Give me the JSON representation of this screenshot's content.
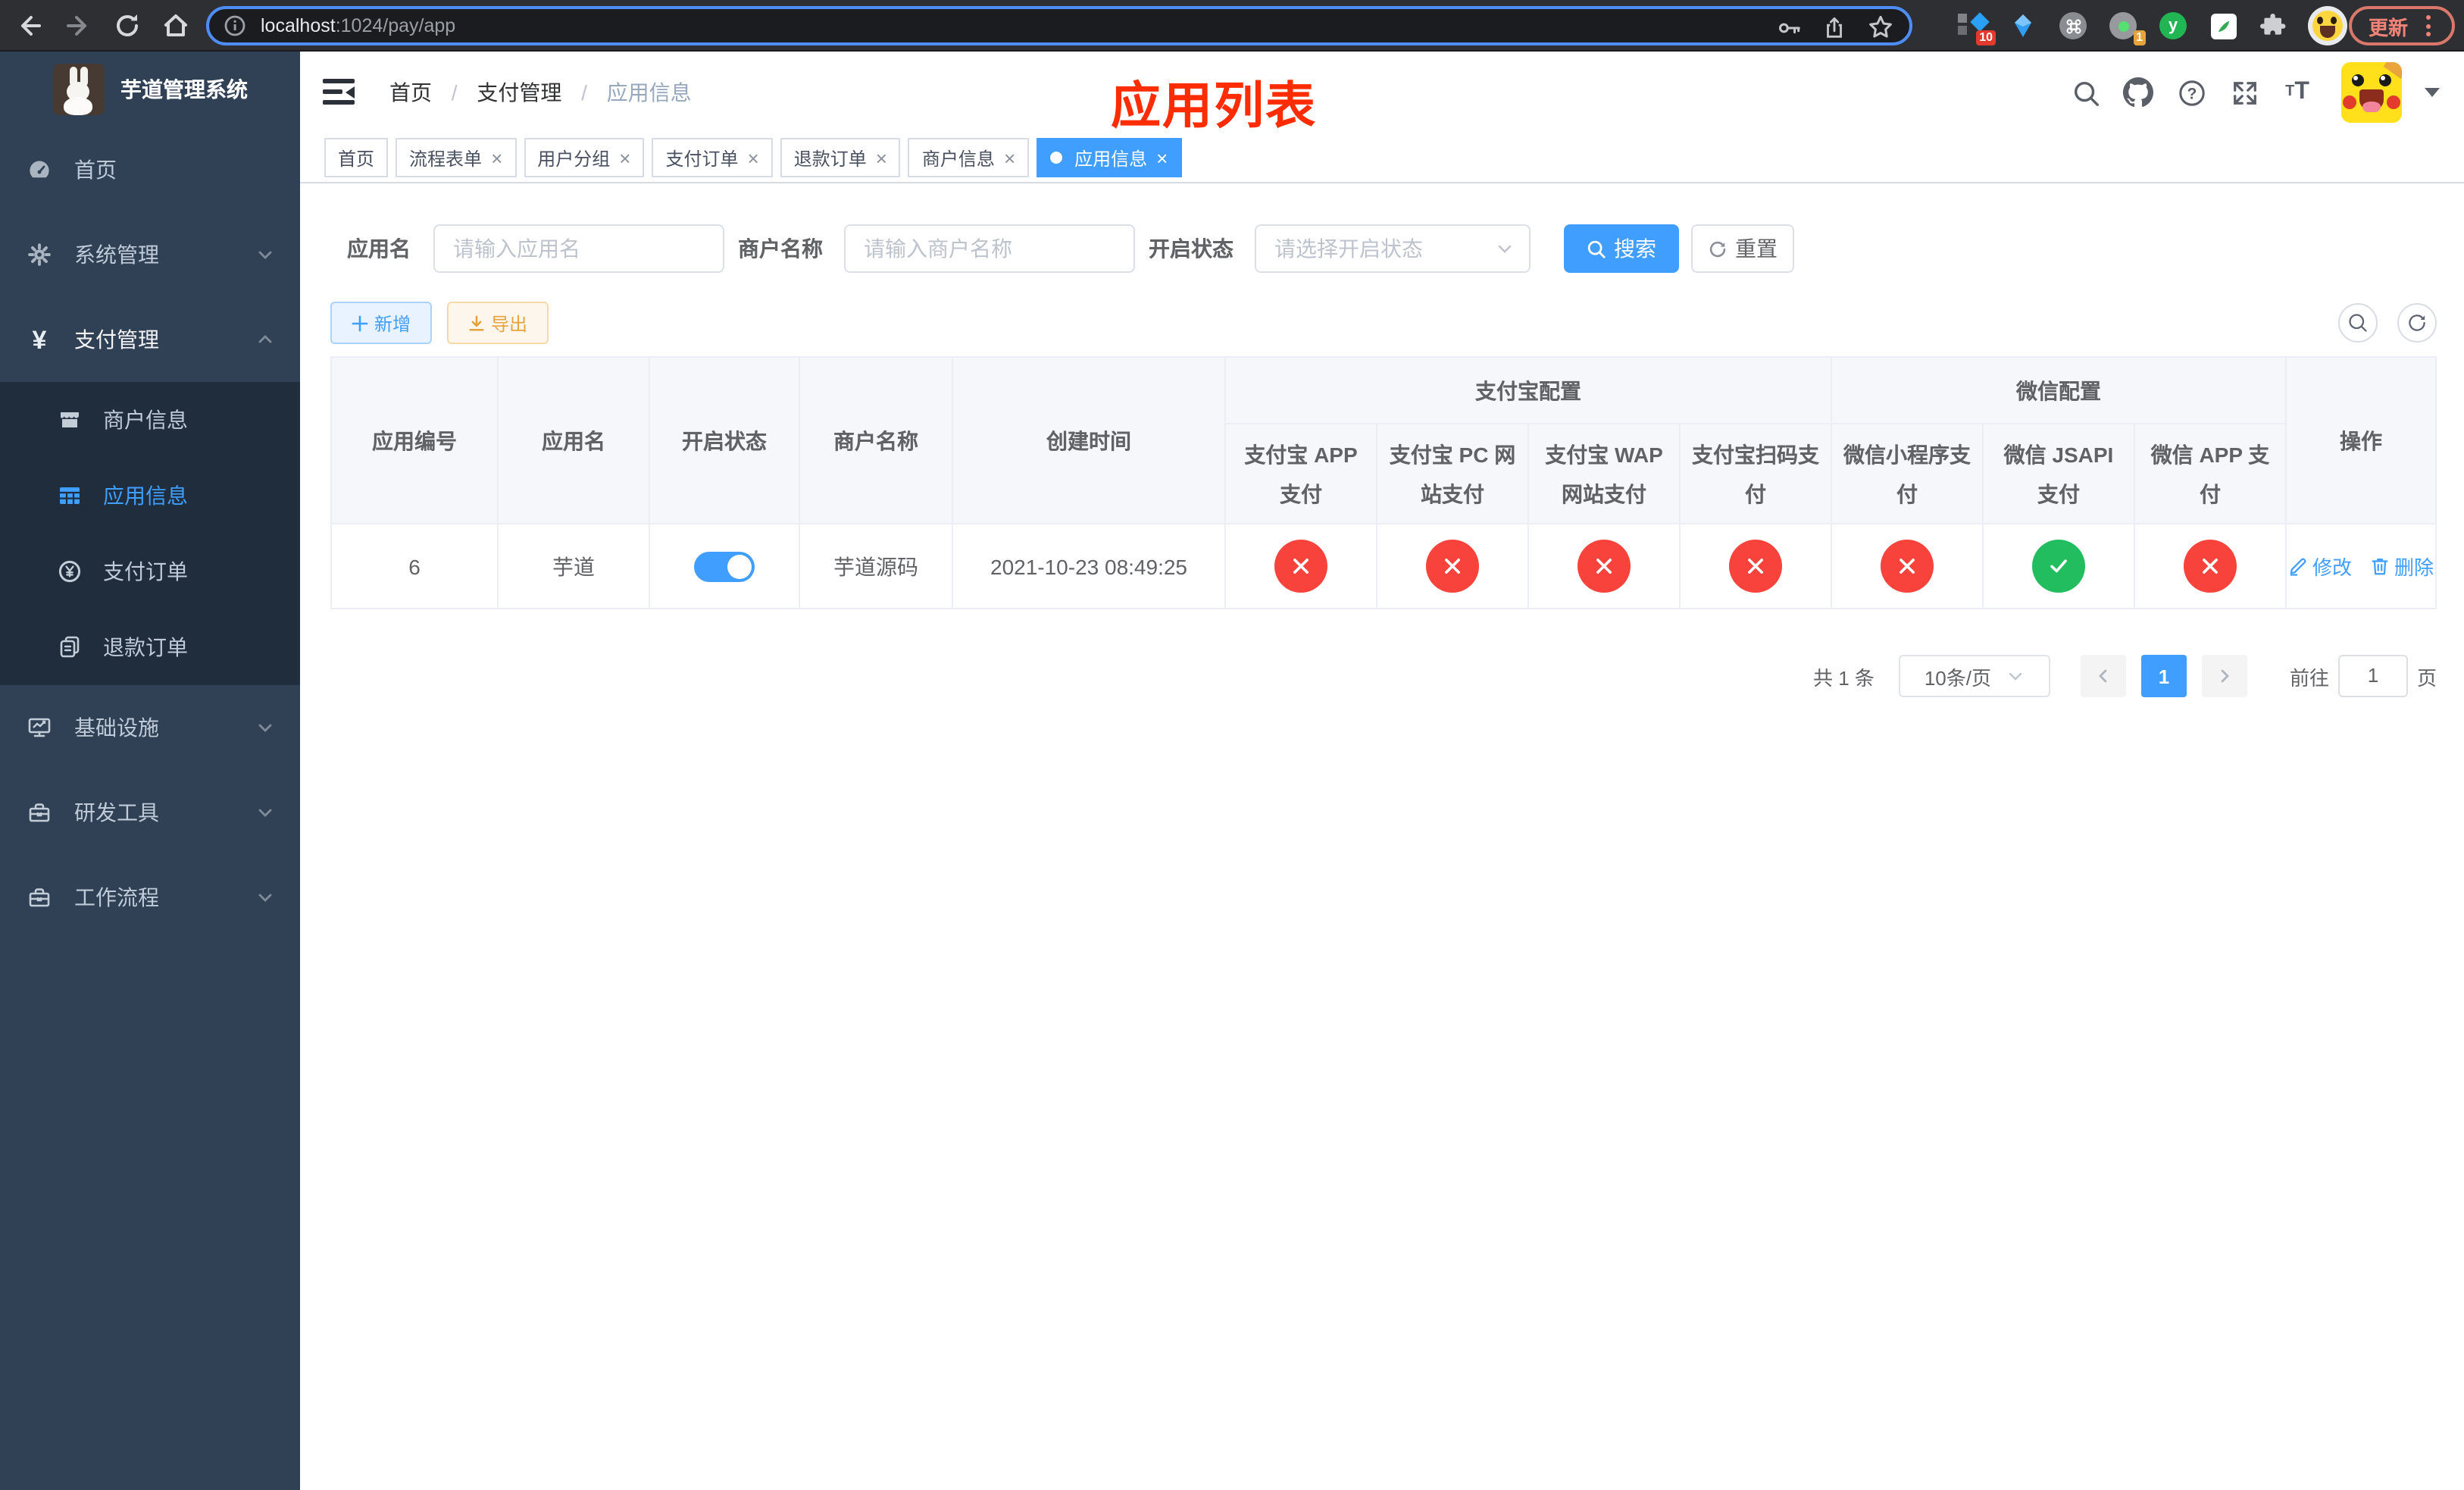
{
  "browser": {
    "url_host": "localhost",
    "url_path": ":1024/pay/app",
    "update_label": "更新",
    "ext_badge_10": "10",
    "ext_badge_1": "1",
    "ext_y_label": "y"
  },
  "sidebar": {
    "title": "芋道管理系统",
    "menu": [
      {
        "label": "首页"
      },
      {
        "label": "系统管理"
      },
      {
        "label": "支付管理"
      },
      {
        "label": "基础设施"
      },
      {
        "label": "研发工具"
      },
      {
        "label": "工作流程"
      }
    ],
    "submenu": [
      {
        "label": "商户信息"
      },
      {
        "label": "应用信息"
      },
      {
        "label": "支付订单"
      },
      {
        "label": "退款订单"
      }
    ]
  },
  "navbar": {
    "breadcrumb": [
      "首页",
      "支付管理",
      "应用信息"
    ],
    "overlay_title": "应用列表"
  },
  "tabs": [
    "首页",
    "流程表单",
    "用户分组",
    "支付订单",
    "退款订单",
    "商户信息",
    "应用信息"
  ],
  "filter": {
    "app_name_label": "应用名",
    "app_name_placeholder": "请输入应用名",
    "merchant_label": "商户名称",
    "merchant_placeholder": "请输入商户名称",
    "status_label": "开启状态",
    "status_placeholder": "请选择开启状态",
    "search_label": "搜索",
    "reset_label": "重置"
  },
  "toolbar": {
    "add_label": "新增",
    "export_label": "导出"
  },
  "table": {
    "columns": [
      "应用编号",
      "应用名",
      "开启状态",
      "商户名称",
      "创建时间"
    ],
    "groups": [
      "支付宝配置",
      "微信配置"
    ],
    "pay_columns": [
      "支付宝 APP 支付",
      "支付宝 PC 网站支付",
      "支付宝 WAP 网站支付",
      "支付宝扫码支付",
      "微信小程序支付",
      "微信 JSAPI 支付",
      "微信 APP 支付"
    ],
    "ops_column": "操作",
    "row": {
      "id": "6",
      "name": "芋道",
      "enabled": true,
      "merchant": "芋道源码",
      "created": "2021-10-23 08:49:25",
      "channels": [
        "fail",
        "fail",
        "fail",
        "fail",
        "fail",
        "pass",
        "fail"
      ],
      "edit_label": "修改",
      "delete_label": "删除"
    }
  },
  "pagination": {
    "total": "共 1 条",
    "size": "10条/页",
    "page": "1",
    "goto_label": "前往",
    "goto_value": "1",
    "page_unit": "页"
  },
  "colors": {
    "accent": "#409eff",
    "danger": "#f8433c",
    "success": "#22bd5e",
    "warning": "#e6a23c",
    "annotation": "#fe2c00",
    "sidebar_bg": "#304156",
    "submenu_bg": "#1f2d3d"
  }
}
